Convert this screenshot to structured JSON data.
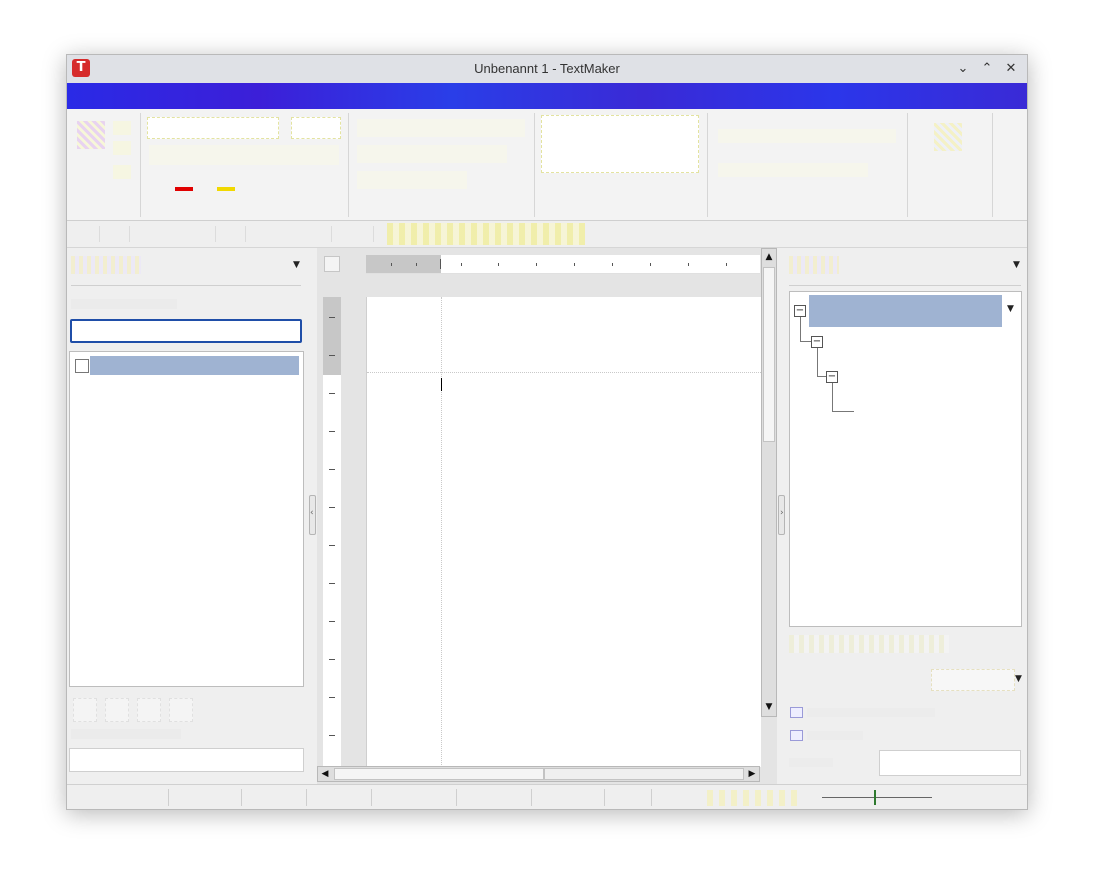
{
  "window": {
    "title": "Unbenannt 1 - TextMaker",
    "app_icon_letter": "T",
    "controls": {
      "minimize": "⌄",
      "maximize": "⌃",
      "close": "✕"
    }
  },
  "icons": {
    "app": "textmaker-app-icon",
    "minimize": "chevron-down-icon",
    "maximize": "chevron-up-icon",
    "close": "close-icon",
    "dropdown": "triangle-down-icon",
    "scroll_up": "triangle-up-icon",
    "scroll_down": "triangle-down-icon",
    "scroll_left": "triangle-left-icon",
    "scroll_right": "triangle-right-icon",
    "tree_collapse": "minus-box-icon"
  },
  "colors": {
    "titlebar": "#dfe1e6",
    "ribbon_tabs": "#2a2ae6",
    "selection": "#9fb3d2",
    "search_border": "#1f4ea8",
    "font_color_swatch": "#e00000",
    "highlight_swatch": "#f1d800",
    "zoom_knob": "#2f7a2f"
  },
  "glyphs": {
    "dropdown": "▼",
    "up": "▲",
    "down": "▼",
    "left": "◀",
    "right": "▶",
    "minus": "−",
    "splitter_left": "‹",
    "splitter_right": "›"
  }
}
